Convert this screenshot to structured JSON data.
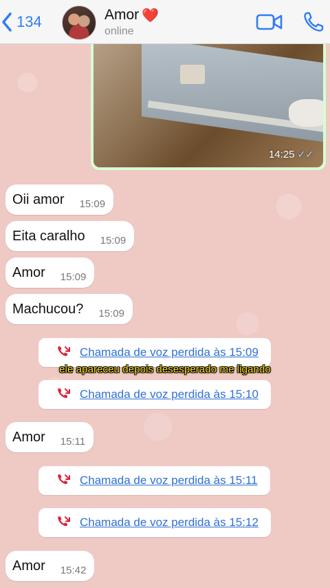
{
  "header": {
    "back_count": "134",
    "contact_name": "Amor",
    "name_emoji": "❤️",
    "status": "online"
  },
  "media_message": {
    "time": "14:25",
    "ticks": "✓✓"
  },
  "messages": [
    {
      "text": "Oii amor",
      "time": "15:09"
    },
    {
      "text": "Eita caralho",
      "time": "15:09"
    },
    {
      "text": "Amor",
      "time": "15:09"
    },
    {
      "text": "Machucou?",
      "time": "15:09"
    },
    {
      "text": "Amor",
      "time": "15:11"
    },
    {
      "text": "Amor",
      "time": "15:42"
    }
  ],
  "calls": [
    {
      "text": "Chamada de voz perdida às 15:09"
    },
    {
      "text": "Chamada de voz perdida às 15:10"
    },
    {
      "text": "Chamada de voz perdida às 15:11"
    },
    {
      "text": "Chamada de voz perdida às 15:12"
    }
  ],
  "caption": "ele apareceu depois desesperado me ligando",
  "colors": {
    "accent": "#2f7cf6",
    "missed_call": "#e0213a",
    "outgoing_bubble": "#d9fdd3",
    "caption": "#ffe21a"
  },
  "icons": {
    "back": "chevron-left-icon",
    "video": "video-camera-icon",
    "phone": "phone-icon",
    "missed_call": "missed-call-icon"
  }
}
